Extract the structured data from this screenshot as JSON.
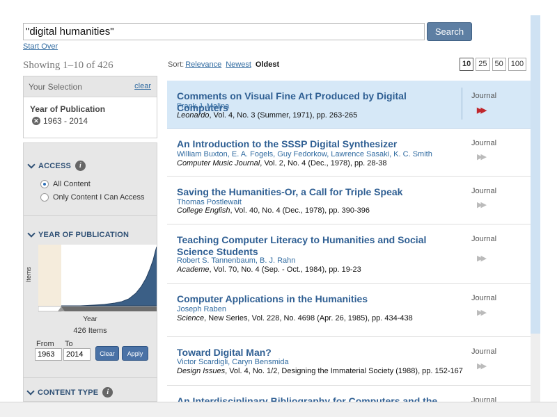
{
  "search": {
    "value": "\"digital humanities\"",
    "button": "Search",
    "start_over": "Start Over"
  },
  "showing": "Showing 1–10 of 426",
  "selection": {
    "header": "Your Selection",
    "clear": "clear",
    "facet": "Year of Publication",
    "value": "1963 - 2014"
  },
  "facets": {
    "access": {
      "title": "ACCESS",
      "options": [
        "All Content",
        "Only Content I Can Access"
      ],
      "selected": 0
    },
    "year": {
      "title": "YEAR OF PUBLICATION",
      "y_axis": "Items",
      "x_axis": "Year",
      "items_count": "426 Items",
      "from_label": "From",
      "to_label": "To",
      "from_value": "1963",
      "to_value": "2014",
      "clear_btn": "Clear",
      "apply_btn": "Apply"
    },
    "content_type": {
      "title": "CONTENT TYPE"
    }
  },
  "sort": {
    "label": "Sort:",
    "options": [
      "Relevance",
      "Newest",
      "Oldest"
    ],
    "active": "Oldest"
  },
  "page_sizes": [
    "10",
    "25",
    "50",
    "100"
  ],
  "page_size_active": "10",
  "results": [
    {
      "title": "Comments on Visual Fine Art Produced by Digital Computers",
      "authors": "Frank J. Malina",
      "journal": "Leonardo",
      "citation": ", Vol. 4, No. 3 (Summer, 1971), pp. 263-265",
      "type": "Journal"
    },
    {
      "title": "An Introduction to the SSSP Digital Synthesizer",
      "authors": "William Buxton, E. A. Fogels, Guy Fedorkow, Lawrence Sasaki, K. C. Smith",
      "journal": "Computer Music Journal",
      "citation": ", Vol. 2, No. 4 (Dec., 1978), pp. 28-38",
      "type": "Journal"
    },
    {
      "title": "Saving the Humanities-Or, a Call for Triple Speak",
      "authors": "Thomas Postlewait",
      "journal": "College English",
      "citation": ", Vol. 40, No. 4 (Dec., 1978), pp. 390-396",
      "type": "Journal"
    },
    {
      "title": "Teaching Computer Literacy to Humanities and Social Science Students",
      "authors": "Robert S. Tannenbaum, B. J. Rahn",
      "journal": "Academe",
      "citation": ", Vol. 70, No. 4 (Sep. - Oct., 1984), pp. 19-23",
      "type": "Journal"
    },
    {
      "title": "Computer Applications in the Humanities",
      "authors": "Joseph Raben",
      "journal": "Science",
      "citation": ", New Series, Vol. 228, No. 4698 (Apr. 26, 1985), pp. 434-438",
      "type": "Journal"
    },
    {
      "title": "Toward Digital Man?",
      "authors": "Victor Scardigli, Caryn Bensmida",
      "journal": "Design Issues",
      "citation": ", Vol. 4, No. 1/2, Designing the Immaterial Society (1988), pp. 152-167",
      "type": "Journal"
    },
    {
      "title": "An Interdisciplinary Bibliography for Computers and the",
      "authors": "",
      "journal": "",
      "citation": "",
      "type": "Journal"
    }
  ],
  "colors": {
    "accent": "#2f5f93",
    "highlight": "#d6e8f7",
    "arrow_active": "#c0272d",
    "chart_fill": "#3b5f86"
  }
}
